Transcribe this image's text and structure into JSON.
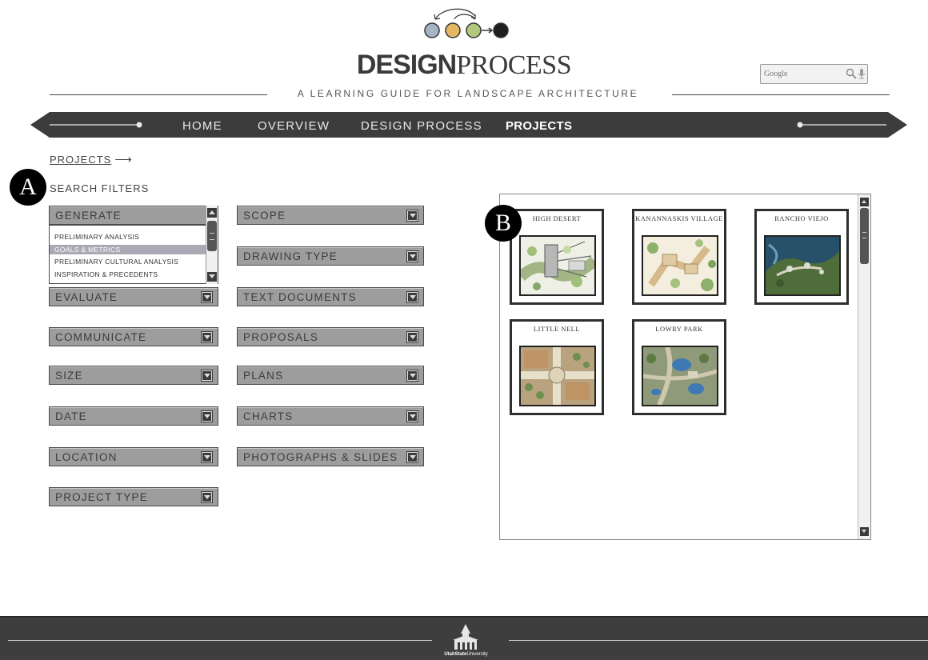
{
  "brand": {
    "title_bold": "DESIGN",
    "title_light": "PROCESS",
    "tagline": "A LEARNING GUIDE FOR LANDSCAPE ARCHITECTURE",
    "logo_colors": [
      "#a6b3c7",
      "#e4b863",
      "#b2c97b",
      "#1f1f1f"
    ]
  },
  "search": {
    "placeholder": "Google"
  },
  "nav": {
    "items": [
      {
        "label": "HOME"
      },
      {
        "label": "OVERVIEW"
      },
      {
        "label": "DESIGN PROCESS"
      },
      {
        "label": "PROJECTS",
        "active": true
      }
    ]
  },
  "breadcrumb": {
    "label": "PROJECTS",
    "arrow": "⟶"
  },
  "markers": {
    "a": "A",
    "b": "B"
  },
  "filters": {
    "title": "SEARCH FILTERS",
    "left": [
      "GENERATE",
      "EVALUATE",
      "COMMUNICATE",
      "SIZE",
      "DATE",
      "LOCATION",
      "PROJECT TYPE"
    ],
    "right": [
      "SCOPE",
      "DRAWING TYPE",
      "TEXT DOCUMENTS",
      "PROPOSALS",
      "PLANS",
      "CHARTS",
      "PHOTOGRAPHS & SLIDES"
    ],
    "generate_options": [
      "PRELIMINARY ANALYSIS",
      "GOALS & METRICS",
      "PRELIMINARY CULTURAL ANALYSIS",
      "INSPIRATION & PRECEDENTS"
    ],
    "generate_selected": "GOALS & METRICS"
  },
  "projects": [
    {
      "title": "HIGH DESERT"
    },
    {
      "title": "KANANNASKIS VILLAGE"
    },
    {
      "title": "RANCHO VIEJO"
    },
    {
      "title": "LITTLE NELL"
    },
    {
      "title": "LOWRY PARK"
    }
  ],
  "footer": {
    "logo_text_bold": "UtahState",
    "logo_text": "University"
  }
}
